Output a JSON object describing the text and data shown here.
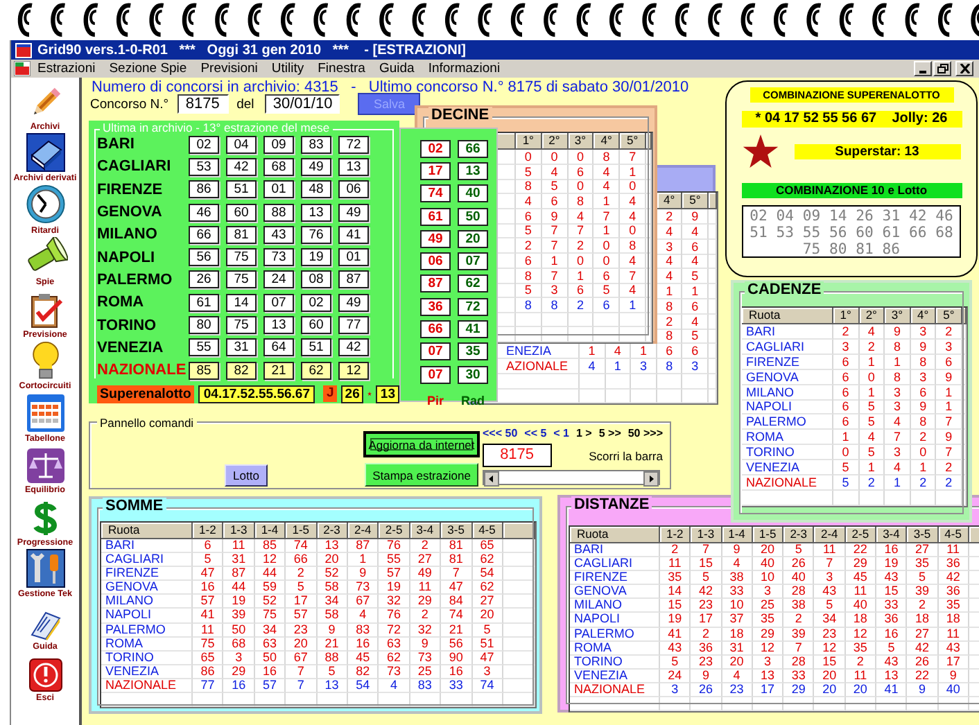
{
  "window": {
    "title": "Grid90 vers.1-0-R01   ***   Oggi 31 gen 2010   ***    - [ESTRAZIONI]"
  },
  "menu": [
    "Estrazioni",
    "Sezione Spie",
    "Previsioni",
    "Utility",
    "Finestra",
    "Guida",
    "Informazioni"
  ],
  "toolbar": [
    {
      "label": "Archivi"
    },
    {
      "label": "Archivi derivati"
    },
    {
      "label": "Ritardi"
    },
    {
      "label": "Spie"
    },
    {
      "label": "Previsione"
    },
    {
      "label": "Cortocircuiti"
    },
    {
      "label": "Tabellone"
    },
    {
      "label": "Equilibrio"
    },
    {
      "label": "Progressione"
    },
    {
      "label": "Gestione Tek"
    },
    {
      "label": "Guida"
    },
    {
      "label": "Esci"
    }
  ],
  "header": {
    "info": "Numero di concorsi in archivio: 4315   -   Ultimo concorso N.° 8175 di sabato 30/01/2010",
    "concorso_label": "Concorso N.°",
    "concorso": "8175",
    "del_label": "del",
    "date": "30/01/10",
    "save_button": {
      "label": "Salva",
      "disabled": true
    }
  },
  "estrazione": {
    "legend": "Ultima in archivio - 13° estrazione del mese",
    "rows": [
      {
        "ruota": "BARI",
        "kind": "ruota",
        "numbers": [
          "02",
          "04",
          "09",
          "83",
          "72"
        ]
      },
      {
        "ruota": "CAGLIARI",
        "kind": "ruota",
        "numbers": [
          "53",
          "42",
          "68",
          "49",
          "13"
        ]
      },
      {
        "ruota": "FIRENZE",
        "kind": "ruota",
        "numbers": [
          "86",
          "51",
          "01",
          "48",
          "06"
        ]
      },
      {
        "ruota": "GENOVA",
        "kind": "ruota",
        "numbers": [
          "46",
          "60",
          "88",
          "13",
          "49"
        ]
      },
      {
        "ruota": "MILANO",
        "kind": "ruota",
        "numbers": [
          "66",
          "81",
          "43",
          "76",
          "41"
        ]
      },
      {
        "ruota": "NAPOLI",
        "kind": "ruota",
        "numbers": [
          "56",
          "75",
          "73",
          "19",
          "01"
        ]
      },
      {
        "ruota": "PALERMO",
        "kind": "ruota",
        "numbers": [
          "26",
          "75",
          "24",
          "08",
          "87"
        ]
      },
      {
        "ruota": "ROMA",
        "kind": "ruota",
        "numbers": [
          "61",
          "14",
          "07",
          "02",
          "49"
        ]
      },
      {
        "ruota": "TORINO",
        "kind": "ruota",
        "numbers": [
          "80",
          "75",
          "13",
          "60",
          "77"
        ]
      },
      {
        "ruota": "VENEZIA",
        "kind": "ruota",
        "numbers": [
          "55",
          "31",
          "64",
          "51",
          "42"
        ]
      },
      {
        "ruota": "NAZIONALE",
        "kind": "nazionale",
        "numbers": [
          "85",
          "82",
          "21",
          "62",
          "12"
        ]
      }
    ],
    "superenalotto": {
      "label": "Superenalotto",
      "numbers": "04.17.52.55.56.67",
      "jolly_label": "J",
      "jolly": "26",
      "superstar": "13"
    }
  },
  "pir_rad": {
    "rows": [
      {
        "pir": "02",
        "rad": "66"
      },
      {
        "pir": "17",
        "rad": "13"
      },
      {
        "pir": "74",
        "rad": "40"
      },
      {
        "pir": "61",
        "rad": "50"
      },
      {
        "pir": "49",
        "rad": "20"
      },
      {
        "pir": "06",
        "rad": "07"
      },
      {
        "pir": "87",
        "rad": "62"
      },
      {
        "pir": "36",
        "rad": "72"
      },
      {
        "pir": "66",
        "rad": "41"
      },
      {
        "pir": "07",
        "rad": "35"
      },
      {
        "pir": "07",
        "rad": "30"
      }
    ],
    "pir_label": "Pir",
    "rad_label": "Rad"
  },
  "back_panel": {
    "columns": [
      "4°",
      "5°"
    ],
    "rows": [
      {
        "kind": "ruota",
        "values": [
          "2",
          "9"
        ]
      },
      {
        "kind": "ruota",
        "values": [
          "4",
          "4"
        ]
      },
      {
        "kind": "ruota",
        "values": [
          "3",
          "6"
        ]
      },
      {
        "kind": "ruota",
        "values": [
          "4",
          "4"
        ]
      },
      {
        "kind": "ruota",
        "values": [
          "4",
          "5"
        ]
      },
      {
        "kind": "ruota",
        "values": [
          "1",
          "1"
        ]
      },
      {
        "kind": "ruota",
        "values": [
          "8",
          "6"
        ]
      },
      {
        "kind": "ruota",
        "values": [
          "2",
          "4"
        ]
      },
      {
        "kind": "ruota",
        "values": [
          "8",
          "5"
        ]
      },
      {
        "kind": "ruota",
        "ruota": "ENEZIA",
        "values": [
          "1",
          "4",
          "1",
          "6",
          "6"
        ]
      },
      {
        "kind": "nazionale",
        "ruota": "AZIONALE",
        "values": [
          "4",
          "1",
          "3",
          "8",
          "3"
        ]
      }
    ]
  },
  "decine": {
    "title": "DECINE",
    "columns": [
      "1°",
      "2°",
      "3°",
      "4°",
      "5°"
    ],
    "rows": [
      {
        "kind": "ruota",
        "values": [
          "0",
          "0",
          "0",
          "8",
          "7"
        ]
      },
      {
        "kind": "ruota",
        "values": [
          "5",
          "4",
          "6",
          "4",
          "1"
        ]
      },
      {
        "kind": "ruota",
        "values": [
          "8",
          "5",
          "0",
          "4",
          "0"
        ]
      },
      {
        "kind": "ruota",
        "values": [
          "4",
          "6",
          "8",
          "1",
          "4"
        ]
      },
      {
        "kind": "ruota",
        "values": [
          "6",
          "9",
          "4",
          "7",
          "4"
        ]
      },
      {
        "kind": "ruota",
        "values": [
          "5",
          "7",
          "7",
          "1",
          "0"
        ]
      },
      {
        "kind": "ruota",
        "values": [
          "2",
          "7",
          "2",
          "0",
          "8"
        ]
      },
      {
        "kind": "ruota",
        "values": [
          "6",
          "1",
          "0",
          "0",
          "4"
        ]
      },
      {
        "kind": "ruota",
        "values": [
          "8",
          "7",
          "1",
          "6",
          "7"
        ]
      },
      {
        "kind": "ruota",
        "values": [
          "5",
          "3",
          "6",
          "5",
          "4"
        ]
      },
      {
        "kind": "nazionale",
        "values": [
          "8",
          "8",
          "2",
          "6",
          "1"
        ]
      }
    ]
  },
  "combinazione": {
    "title": "COMBINAZIONE SUPERENALOTTO",
    "line": "* 04 17 52 55 56 67    Jolly: 26",
    "superstar": "Superstar: 13",
    "lotto_title": "COMBINAZIONE 10 e Lotto",
    "lotto_numbers": "02 04 09 14 26 31 42 46 51 53 55 56 60 61 66 68 75 80 81 86"
  },
  "cadenze": {
    "title": "CADENZE",
    "ruota_label": "Ruota",
    "columns": [
      "1°",
      "2°",
      "3°",
      "4°",
      "5°"
    ],
    "rows": [
      {
        "ruota": "BARI",
        "kind": "ruota",
        "values": [
          "2",
          "4",
          "9",
          "3",
          "2"
        ]
      },
      {
        "ruota": "CAGLIARI",
        "kind": "ruota",
        "values": [
          "3",
          "2",
          "8",
          "9",
          "3"
        ]
      },
      {
        "ruota": "FIRENZE",
        "kind": "ruota",
        "values": [
          "6",
          "1",
          "1",
          "8",
          "6"
        ]
      },
      {
        "ruota": "GENOVA",
        "kind": "ruota",
        "values": [
          "6",
          "0",
          "8",
          "3",
          "9"
        ]
      },
      {
        "ruota": "MILANO",
        "kind": "ruota",
        "values": [
          "6",
          "1",
          "3",
          "6",
          "1"
        ]
      },
      {
        "ruota": "NAPOLI",
        "kind": "ruota",
        "values": [
          "6",
          "5",
          "3",
          "9",
          "1"
        ]
      },
      {
        "ruota": "PALERMO",
        "kind": "ruota",
        "values": [
          "6",
          "5",
          "4",
          "8",
          "7"
        ]
      },
      {
        "ruota": "ROMA",
        "kind": "ruota",
        "values": [
          "1",
          "4",
          "7",
          "2",
          "9"
        ]
      },
      {
        "ruota": "TORINO",
        "kind": "ruota",
        "values": [
          "0",
          "5",
          "3",
          "0",
          "7"
        ]
      },
      {
        "ruota": "VENEZIA",
        "kind": "ruota",
        "values": [
          "5",
          "1",
          "4",
          "1",
          "2"
        ]
      },
      {
        "ruota": "NAZIONALE",
        "kind": "nazionale",
        "values": [
          "5",
          "2",
          "1",
          "2",
          "2"
        ]
      }
    ]
  },
  "pannello": {
    "legend": "Pannello comandi",
    "lotto_button": "Lotto",
    "update_button": {
      "label": "Aggiorna da internet",
      "focused": true
    },
    "print_button": "Stampa estrazione",
    "nav": [
      {
        "label": "<<< 50",
        "kind": "back"
      },
      {
        "label": "<< 5",
        "kind": "back"
      },
      {
        "label": "< 1",
        "kind": "back"
      },
      {
        "label": "1 >",
        "kind": "forward"
      },
      {
        "label": "5 >>",
        "kind": "forward"
      },
      {
        "label": "50 >>>",
        "kind": "forward"
      }
    ],
    "scroll_value": "8175",
    "scroll_label": "Scorri la barra"
  },
  "somme": {
    "title": "SOMME",
    "ruota_label": "Ruota",
    "columns": [
      "1-2",
      "1-3",
      "1-4",
      "1-5",
      "2-3",
      "2-4",
      "2-5",
      "3-4",
      "3-5",
      "4-5"
    ],
    "rows": [
      {
        "ruota": "BARI",
        "kind": "ruota",
        "values": [
          "6",
          "11",
          "85",
          "74",
          "13",
          "87",
          "76",
          "2",
          "81",
          "65"
        ]
      },
      {
        "ruota": "CAGLIARI",
        "kind": "ruota",
        "values": [
          "5",
          "31",
          "12",
          "66",
          "20",
          "1",
          "55",
          "27",
          "81",
          "62"
        ]
      },
      {
        "ruota": "FIRENZE",
        "kind": "ruota",
        "values": [
          "47",
          "87",
          "44",
          "2",
          "52",
          "9",
          "57",
          "49",
          "7",
          "54"
        ]
      },
      {
        "ruota": "GENOVA",
        "kind": "ruota",
        "values": [
          "16",
          "44",
          "59",
          "5",
          "58",
          "73",
          "19",
          "11",
          "47",
          "62"
        ]
      },
      {
        "ruota": "MILANO",
        "kind": "ruota",
        "values": [
          "57",
          "19",
          "52",
          "17",
          "34",
          "67",
          "32",
          "29",
          "84",
          "27"
        ]
      },
      {
        "ruota": "NAPOLI",
        "kind": "ruota",
        "values": [
          "41",
          "39",
          "75",
          "57",
          "58",
          "4",
          "76",
          "2",
          "74",
          "20"
        ]
      },
      {
        "ruota": "PALERMO",
        "kind": "ruota",
        "values": [
          "11",
          "50",
          "34",
          "23",
          "9",
          "83",
          "72",
          "32",
          "21",
          "5"
        ]
      },
      {
        "ruota": "ROMA",
        "kind": "ruota",
        "values": [
          "75",
          "68",
          "63",
          "20",
          "21",
          "16",
          "63",
          "9",
          "56",
          "51"
        ]
      },
      {
        "ruota": "TORINO",
        "kind": "ruota",
        "values": [
          "65",
          "3",
          "50",
          "67",
          "88",
          "45",
          "62",
          "73",
          "90",
          "47"
        ]
      },
      {
        "ruota": "VENEZIA",
        "kind": "ruota",
        "values": [
          "86",
          "29",
          "16",
          "7",
          "5",
          "82",
          "73",
          "25",
          "16",
          "3"
        ]
      },
      {
        "ruota": "NAZIONALE",
        "kind": "nazionale",
        "values": [
          "77",
          "16",
          "57",
          "7",
          "13",
          "54",
          "4",
          "83",
          "33",
          "74"
        ]
      }
    ]
  },
  "distanze": {
    "title": "DISTANZE",
    "ruota_label": "Ruota",
    "columns": [
      "1-2",
      "1-3",
      "1-4",
      "1-5",
      "2-3",
      "2-4",
      "2-5",
      "3-4",
      "3-5",
      "4-5"
    ],
    "rows": [
      {
        "ruota": "BARI",
        "kind": "ruota",
        "values": [
          "2",
          "7",
          "9",
          "20",
          "5",
          "11",
          "22",
          "16",
          "27",
          "11"
        ]
      },
      {
        "ruota": "CAGLIARI",
        "kind": "ruota",
        "values": [
          "11",
          "15",
          "4",
          "40",
          "26",
          "7",
          "29",
          "19",
          "35",
          "36"
        ]
      },
      {
        "ruota": "FIRENZE",
        "kind": "ruota",
        "values": [
          "35",
          "5",
          "38",
          "10",
          "40",
          "3",
          "45",
          "43",
          "5",
          "42"
        ]
      },
      {
        "ruota": "GENOVA",
        "kind": "ruota",
        "values": [
          "14",
          "42",
          "33",
          "3",
          "28",
          "43",
          "11",
          "15",
          "39",
          "36"
        ]
      },
      {
        "ruota": "MILANO",
        "kind": "ruota",
        "values": [
          "15",
          "23",
          "10",
          "25",
          "38",
          "5",
          "40",
          "33",
          "2",
          "35"
        ]
      },
      {
        "ruota": "NAPOLI",
        "kind": "ruota",
        "values": [
          "19",
          "17",
          "37",
          "35",
          "2",
          "34",
          "18",
          "36",
          "18",
          "18"
        ]
      },
      {
        "ruota": "PALERMO",
        "kind": "ruota",
        "values": [
          "41",
          "2",
          "18",
          "29",
          "39",
          "23",
          "12",
          "16",
          "27",
          "11"
        ]
      },
      {
        "ruota": "ROMA",
        "kind": "ruota",
        "values": [
          "43",
          "36",
          "31",
          "12",
          "7",
          "12",
          "35",
          "5",
          "42",
          "43"
        ]
      },
      {
        "ruota": "TORINO",
        "kind": "ruota",
        "values": [
          "5",
          "23",
          "20",
          "3",
          "28",
          "15",
          "2",
          "43",
          "26",
          "17"
        ]
      },
      {
        "ruota": "VENEZIA",
        "kind": "ruota",
        "values": [
          "24",
          "9",
          "4",
          "13",
          "33",
          "20",
          "11",
          "13",
          "22",
          "9"
        ]
      },
      {
        "ruota": "NAZIONALE",
        "kind": "nazionale",
        "values": [
          "3",
          "26",
          "23",
          "17",
          "29",
          "20",
          "20",
          "41",
          "9",
          "40"
        ]
      }
    ]
  }
}
